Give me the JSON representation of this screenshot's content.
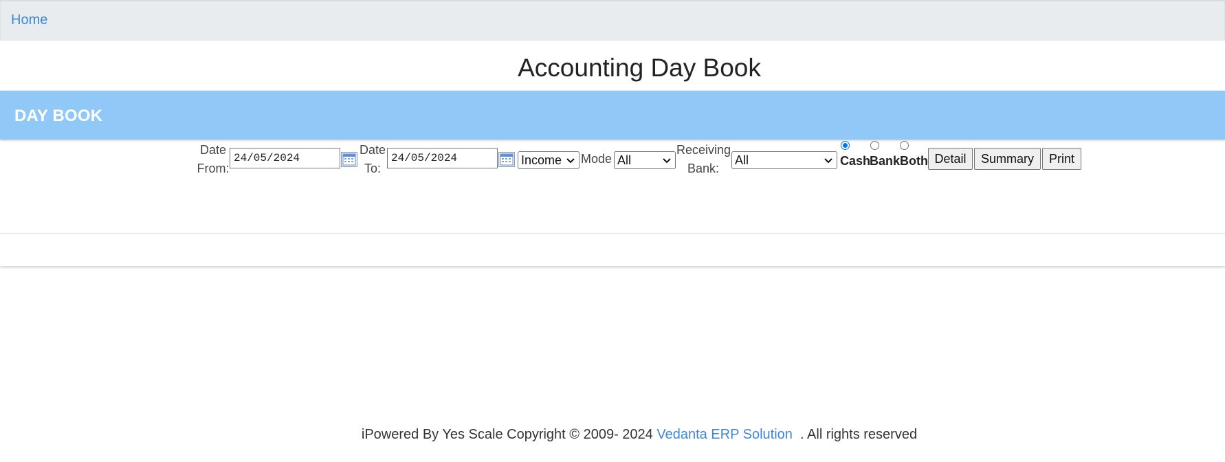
{
  "nav": {
    "home_label": "Home"
  },
  "page": {
    "title": "Accounting Day Book"
  },
  "card": {
    "header_title": "DAY BOOK"
  },
  "filters": {
    "date_from_label_line1": "Date",
    "date_from_label_line2": "From:",
    "date_from_value": "24/05/2024",
    "date_to_label_line1": "Date",
    "date_to_label_line2": "To:",
    "date_to_value": "24/05/2024",
    "type_value": "Income",
    "mode_label": "Mode",
    "mode_value": "All",
    "receiving_bank_label_line1": "Receiving",
    "receiving_bank_label_line2": "Bank:",
    "receiving_bank_value": "All",
    "radio_cash": "Cash",
    "radio_bank": "Bank",
    "radio_both": "Both",
    "selected_radio": "Cash"
  },
  "buttons": {
    "detail": "Detail",
    "summary": "Summary",
    "print": "Print"
  },
  "footer": {
    "prefix": "iPowered By Yes Scale Copyright © 2009- 2024 ",
    "link": "Vedanta ERP Solution",
    "suffix": "  . All rights reserved"
  },
  "colors": {
    "accent_link": "#3f86d6",
    "card_header": "#90c9f7",
    "topbar": "#e9ecef"
  }
}
